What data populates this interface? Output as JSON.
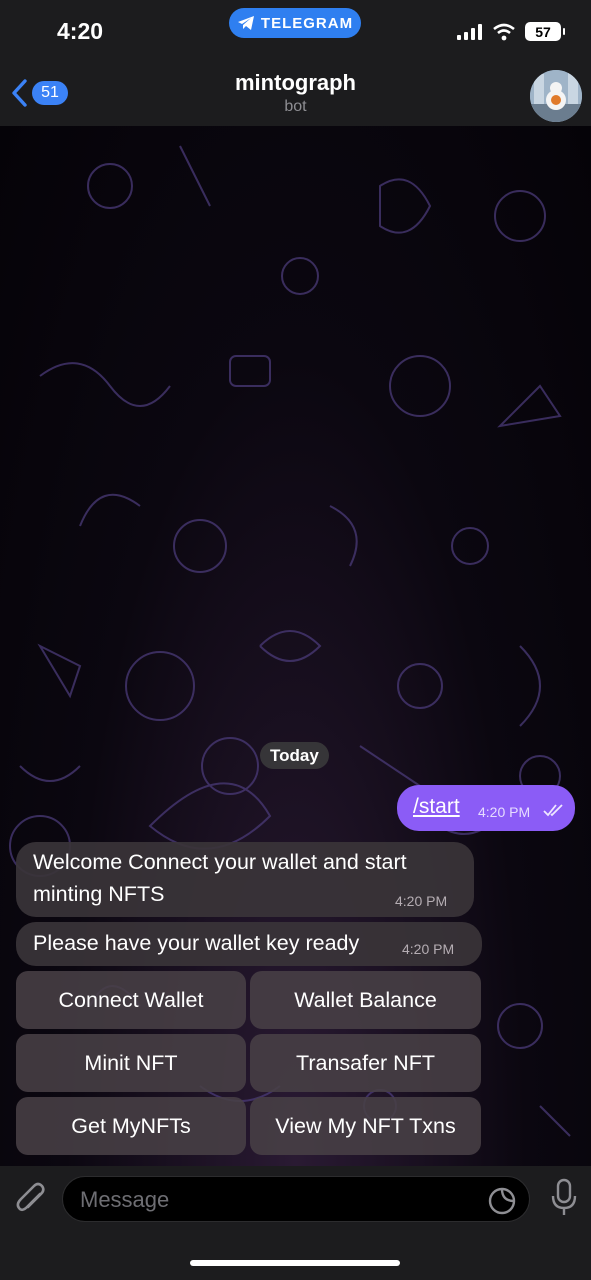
{
  "status_bar": {
    "time": "4:20",
    "return_pill": "TELEGRAM",
    "battery": "57"
  },
  "header": {
    "back_count": "51",
    "title": "mintograph",
    "subtitle": "bot"
  },
  "chat": {
    "date_separator": "Today",
    "outgoing": {
      "text": "/start",
      "time": "4:20 PM"
    },
    "incoming": [
      {
        "line1": "Welcome Connect your wallet and start",
        "line2": "minting NFTS",
        "time": "4:20 PM"
      },
      {
        "line1": "Please have your wallet key ready",
        "time": "4:20 PM"
      }
    ],
    "keyboard": [
      [
        "Connect Wallet",
        "Wallet Balance"
      ],
      [
        "Minit NFT",
        "Transafer NFT"
      ],
      [
        "Get MyNFTs",
        "View My NFT Txns"
      ]
    ]
  },
  "composer": {
    "placeholder": "Message"
  },
  "colors": {
    "accent": "#3b82f6",
    "outgoing_bubble": "#8b5cf6",
    "telegram_pill": "#2f7ff0"
  }
}
